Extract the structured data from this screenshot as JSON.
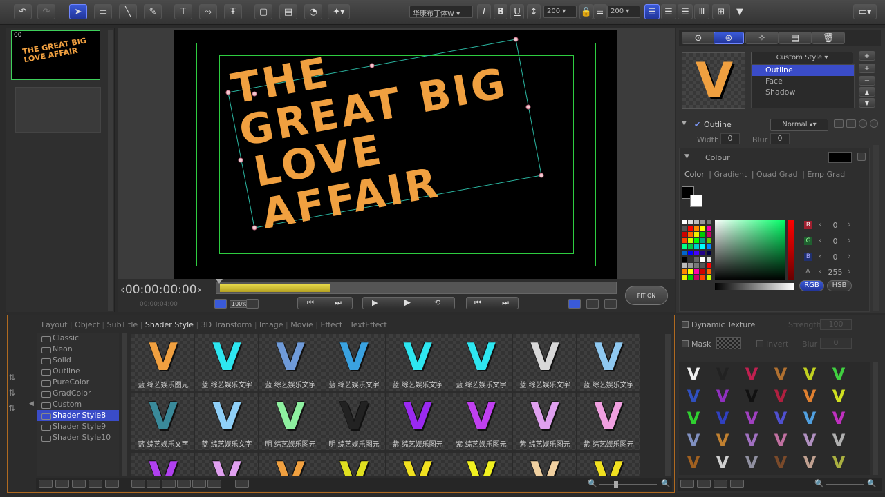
{
  "toolbar": {
    "font_name": "华康布丁体W",
    "italic": "I",
    "bold": "B",
    "underline": "U",
    "font_size": "200",
    "line_size": "200"
  },
  "thumbnails": [
    {
      "index": "00",
      "text": "THE GREAT BIG LOVE AFFAIR"
    }
  ],
  "canvas": {
    "line1": "THE",
    "line2": "GREAT BIG",
    "line3": "LOVE AFFAIR",
    "text_color": "#f0a040",
    "safe_color": "#2ecc40"
  },
  "timeline": {
    "timecode": "00:00:00:00",
    "sub_timecode": "00:00:04:00",
    "zoom": "100%",
    "fit_label": "FIT ON"
  },
  "style_tabs": [
    "Layout",
    "Object",
    "SubTitle",
    "Shader Style",
    "3D Transform",
    "Image",
    "Movie",
    "Effect",
    "TextEffect"
  ],
  "style_active": "Shader Style",
  "style_list": [
    "Classic",
    "Neon",
    "Solid",
    "Outline",
    "PureColor",
    "GradColor",
    "Custom",
    "Shader Style8",
    "Shader Style9",
    "Shader Style10"
  ],
  "style_list_selected": "Shader Style8",
  "preset_captions": [
    "蓝 综艺娱乐图元",
    "蓝 综艺娱乐文字",
    "蓝 综艺娱乐文字",
    "蓝 综艺娱乐文字",
    "蓝 综艺娱乐文字",
    "蓝 综艺娱乐文字",
    "蓝 综艺娱乐文字",
    "蓝 综艺娱乐文字",
    "蓝 综艺娱乐文字",
    "蓝 综艺娱乐文字",
    "明 综艺娱乐图元",
    "明 综艺娱乐图元",
    "紫 综艺娱乐图元",
    "紫 综艺娱乐图元",
    "紫 综艺娱乐图元",
    "紫 综艺娱乐图元"
  ],
  "right_panel": {
    "style_dropdown": "Custom Style",
    "layers": [
      "Outline",
      "Face",
      "Shadow"
    ],
    "selected_layer": "Outline",
    "outline_label": "Outline",
    "blend_mode": "Normal",
    "width_label": "Width",
    "width_value": "0",
    "blur_label": "Blur",
    "blur_value": "0",
    "colour_label": "Colour",
    "color_tabs": [
      "Color",
      "Gradient",
      "Quad Grad",
      "Emp Grad"
    ],
    "r_label": "R",
    "r_value": "0",
    "g_label": "G",
    "g_value": "0",
    "b_label": "B",
    "b_value": "0",
    "a_label": "A",
    "a_value": "255",
    "rgb_btn": "RGB",
    "hsb_btn": "HSB",
    "dynamic_texture": "Dynamic Texture",
    "strength_label": "Strength",
    "strength_value": "100",
    "mask_label": "Mask",
    "invert_label": "Invert",
    "mask_blur_label": "Blur",
    "mask_blur_value": "0"
  }
}
